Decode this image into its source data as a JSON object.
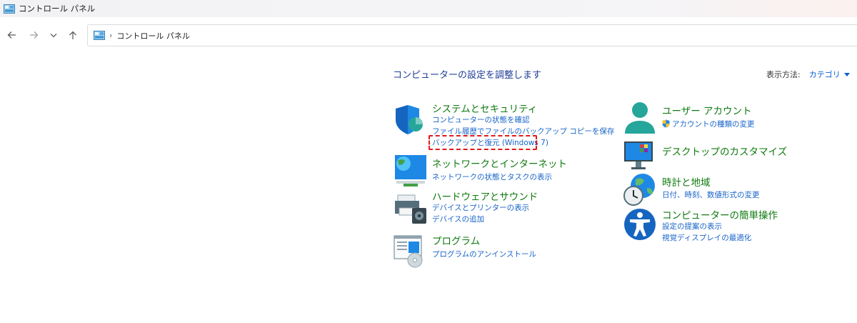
{
  "window": {
    "title": "コントロール パネル"
  },
  "address": {
    "separator": "›",
    "crumb": "コントロール パネル"
  },
  "main": {
    "heading": "コンピューターの設定を調整します",
    "view_by_label": "表示方法:",
    "view_by_value": "カテゴリ"
  },
  "categories": [
    {
      "title": "システムとセキュリティ",
      "links": [
        "コンピューターの状態を確認",
        "ファイル履歴でファイルのバックアップ コピーを保存",
        "バックアップと復元 (Windows 7)"
      ]
    },
    {
      "title": "ネットワークとインターネット",
      "links": [
        "ネットワークの状態とタスクの表示"
      ]
    },
    {
      "title": "ハードウェアとサウンド",
      "links": [
        "デバイスとプリンターの表示",
        "デバイスの追加"
      ]
    },
    {
      "title": "プログラム",
      "links": [
        "プログラムのアンインストール"
      ]
    },
    {
      "title": "ユーザー アカウント",
      "links": [
        "アカウントの種類の変更"
      ]
    },
    {
      "title": "デスクトップのカスタマイズ",
      "links": []
    },
    {
      "title": "時計と地域",
      "links": [
        "日付、時刻、数値形式の変更"
      ]
    },
    {
      "title": "コンピューターの簡単操作",
      "links": [
        "設定の提案の表示",
        "視覚ディスプレイの最適化"
      ]
    }
  ],
  "colors": {
    "heading": "#1f3d99",
    "category_title": "#0e7a0e",
    "link": "#1864c8",
    "highlight": "#e01a1a"
  },
  "icons": [
    "control-panel-icon",
    "back-arrow-icon",
    "forward-arrow-icon",
    "recent-dropdown-icon",
    "up-arrow-icon",
    "security-shield-icon",
    "network-globe-icon",
    "hardware-printer-icon",
    "programs-icon",
    "user-account-icon",
    "desktop-monitor-icon",
    "clock-globe-icon",
    "accessibility-icon",
    "uac-shield-icon"
  ]
}
